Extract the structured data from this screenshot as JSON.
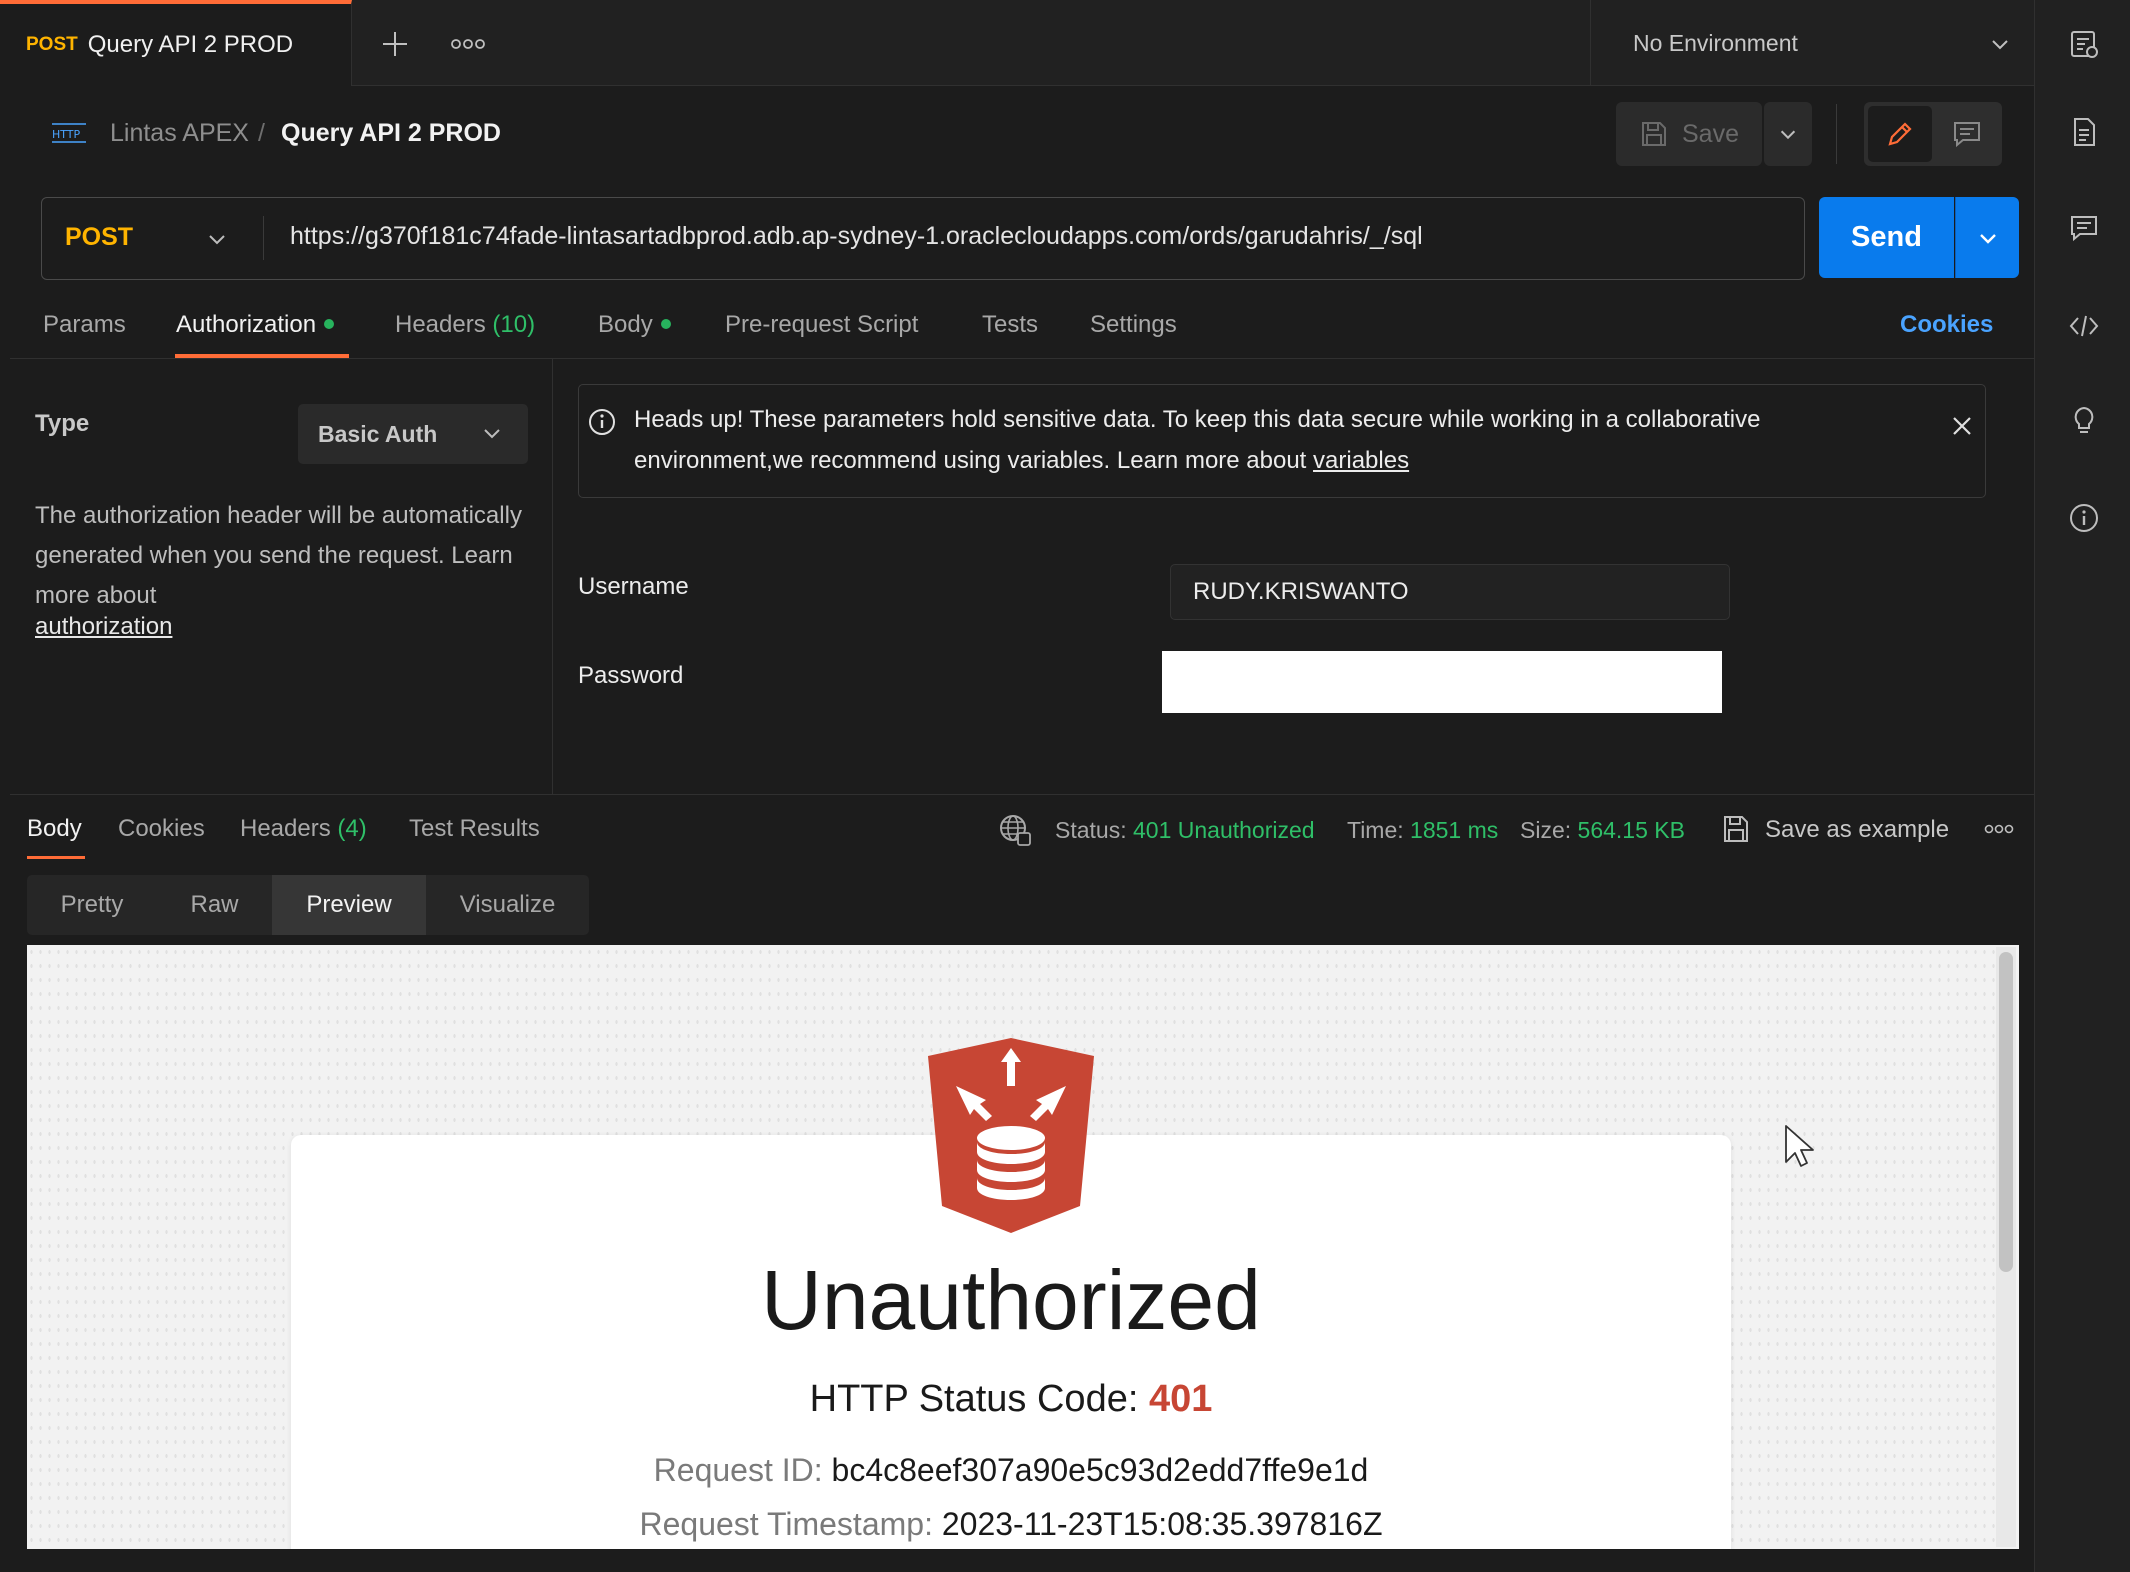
{
  "tabs": [
    {
      "method": "POST",
      "title": "Query API 2 PROD"
    }
  ],
  "environment": "No Environment",
  "breadcrumb": {
    "collection": "Lintas APEX",
    "separator": "/",
    "request": "Query API 2 PROD"
  },
  "toolbar": {
    "save_label": "Save"
  },
  "request": {
    "method": "POST",
    "url": "https://g370f181c74fade-lintasartadbprod.adb.ap-sydney-1.oraclecloudapps.com/ords/garudahris/_/sql",
    "send_label": "Send"
  },
  "request_tabs": {
    "params": "Params",
    "authorization": "Authorization",
    "headers": "Headers",
    "headers_count": "(10)",
    "body": "Body",
    "prerequest": "Pre-request Script",
    "tests": "Tests",
    "settings": "Settings",
    "cookies": "Cookies"
  },
  "auth": {
    "type_label": "Type",
    "type_value": "Basic Auth",
    "description": "The authorization header will be automatically generated when you send the request. Learn more about",
    "link": "authorization",
    "alert_line1": "Heads up! These parameters hold sensitive data. To keep this data secure while working in a collaborative",
    "alert_line2": "environment,we recommend using variables. Learn more about ",
    "alert_link": "variables",
    "username_label": "Username",
    "username_value": "RUDY.KRISWANTO",
    "password_label": "Password"
  },
  "response_tabs": {
    "body": "Body",
    "cookies": "Cookies",
    "headers": "Headers",
    "headers_count": "(4)",
    "test_results": "Test Results"
  },
  "response_meta": {
    "status_label": "Status:",
    "status_value": "401 Unauthorized",
    "time_label": "Time:",
    "time_value": "1851 ms",
    "size_label": "Size:",
    "size_value": "564.15 KB",
    "save_example": "Save as example"
  },
  "view_modes": [
    "Pretty",
    "Raw",
    "Preview",
    "Visualize"
  ],
  "preview": {
    "title": "Unauthorized",
    "status_label": "HTTP Status Code: ",
    "status_code": "401",
    "request_id_label": "Request ID: ",
    "request_id": "bc4c8eef307a90e5c93d2edd7ffe9e1d",
    "timestamp_label": "Request Timestamp: ",
    "timestamp": "2023-11-23T15:08:35.397816Z"
  },
  "colors": {
    "accent": "#ff6c37",
    "send": "#097bed",
    "method": "#ffb400",
    "success_green": "#2fbf68",
    "error_red": "#c74634"
  },
  "icons": [
    "plus-icon",
    "more-icon",
    "chevron-down-icon",
    "http-icon",
    "save-icon",
    "edit-icon",
    "comment-icon",
    "info-icon",
    "close-icon",
    "globe-icon",
    "code-icon",
    "lightbulb-icon",
    "document-icon",
    "env-icon",
    "cursor-icon",
    "oracle-rest-logo"
  ]
}
